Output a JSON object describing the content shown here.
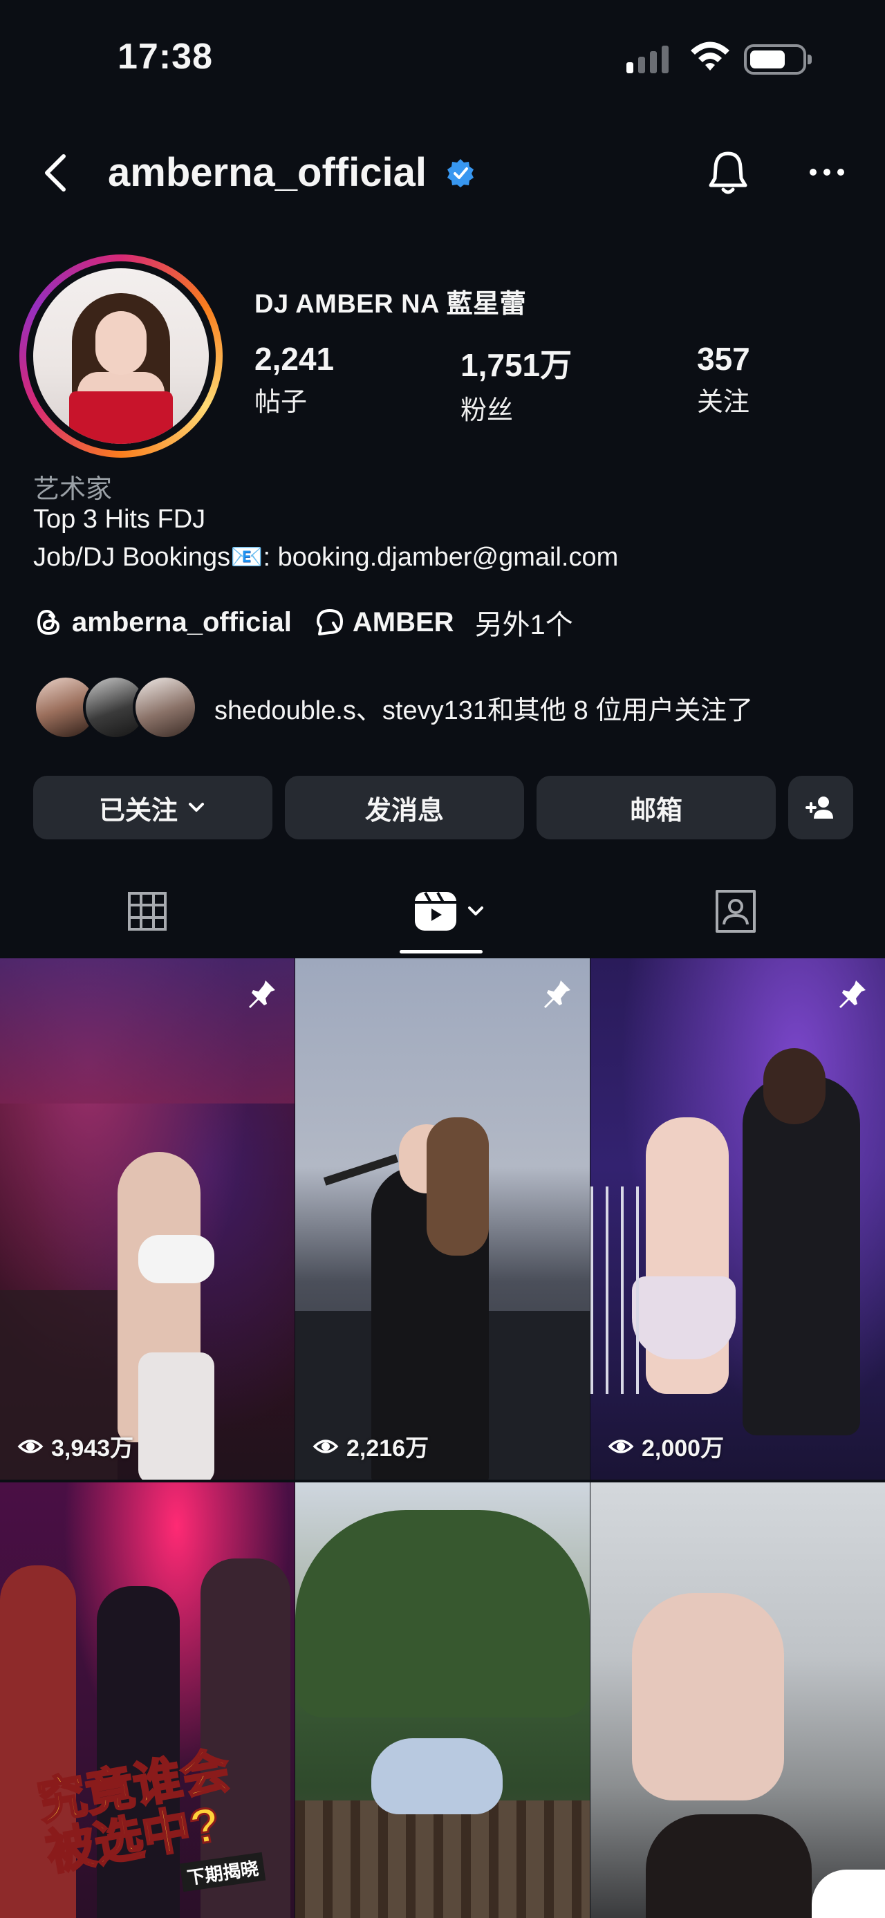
{
  "status_bar": {
    "time": "17:38"
  },
  "header": {
    "username": "amberna_official"
  },
  "profile": {
    "display_name": "DJ AMBER NA 藍星蕾",
    "stats": [
      {
        "value": "2,241",
        "label": "帖子"
      },
      {
        "value": "1,751万",
        "label": "粉丝"
      },
      {
        "value": "357",
        "label": "关注"
      }
    ],
    "category": "艺术家",
    "bio": [
      "Top 3 Hits FDJ",
      "Job/DJ Bookings📧: booking.djamber@gmail.com"
    ],
    "threads_handle": "amberna_official",
    "channel_name": "AMBER",
    "more_links": "另外1个",
    "followed_by": "shedouble.s、stevy131和其他 8 位用户关注了"
  },
  "actions": {
    "following": "已关注",
    "message": "发消息",
    "email": "邮箱"
  },
  "tabs": [
    {
      "icon": "grid-icon"
    },
    {
      "icon": "reels-icon",
      "active": true
    },
    {
      "icon": "tagged-icon"
    }
  ],
  "reels": [
    {
      "views": "3,943万",
      "pinned": true
    },
    {
      "views": "2,216万",
      "pinned": true
    },
    {
      "views": "2,000万",
      "pinned": true
    },
    {
      "views": "",
      "pinned": false,
      "overlay": "究竟谁会\n被选中?",
      "overlay_sub": "下期揭晓"
    },
    {
      "views": "",
      "pinned": false
    },
    {
      "views": "",
      "pinned": false
    }
  ],
  "colors": {
    "background": "#0b0e14",
    "button": "#262a31",
    "verified": "#3897f0",
    "muted_text": "#9aa0a6"
  }
}
